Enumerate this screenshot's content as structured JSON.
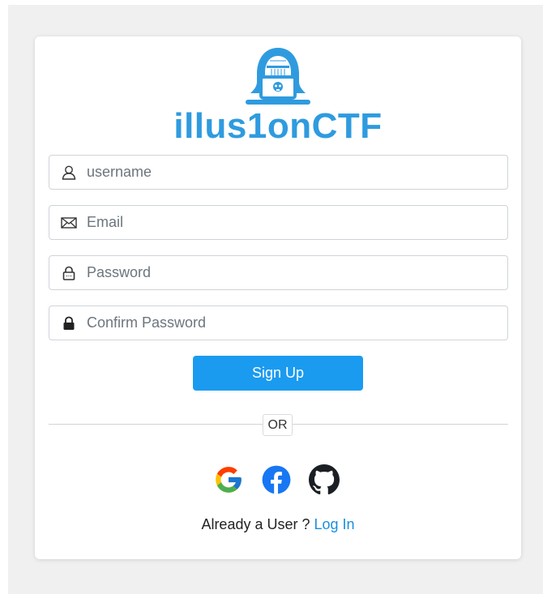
{
  "brand": {
    "name": "illus1onCTF",
    "color": "#2f9bdf"
  },
  "form": {
    "username": {
      "placeholder": "username",
      "icon": "user-outline-icon"
    },
    "email": {
      "placeholder": "Email",
      "icon": "envelope-icon"
    },
    "password": {
      "placeholder": "Password",
      "icon": "lock-outline-icon"
    },
    "confirm_password": {
      "placeholder": "Confirm Password",
      "icon": "lock-filled-icon"
    },
    "submit_label": "Sign Up",
    "submit_color": "#1a9bf0"
  },
  "divider": {
    "label": "OR"
  },
  "social": [
    {
      "icon": "google-icon"
    },
    {
      "icon": "facebook-icon",
      "color": "#1877f2"
    },
    {
      "icon": "github-icon",
      "color": "#1b1f23"
    }
  ],
  "login_prompt": {
    "text": "Already a User ? ",
    "link_label": "Log In"
  }
}
